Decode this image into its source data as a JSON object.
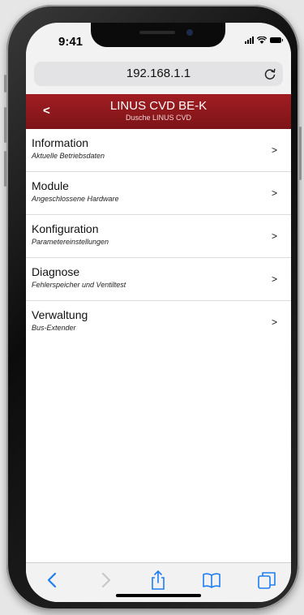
{
  "status": {
    "time": "9:41"
  },
  "browser": {
    "url": "192.168.1.1"
  },
  "header": {
    "back": "<",
    "title": "LINUS CVD BE-K",
    "subtitle": "Dusche LINUS CVD"
  },
  "menu": [
    {
      "label": "Information",
      "desc": "Aktuelle Betriebsdaten",
      "chevron": ">"
    },
    {
      "label": "Module",
      "desc": "Angeschlossene Hardware",
      "chevron": ">"
    },
    {
      "label": "Konfiguration",
      "desc": "Parametereinstellungen",
      "chevron": ">"
    },
    {
      "label": "Diagnose",
      "desc": "Fehlerspeicher und Ventiltest",
      "chevron": ">"
    },
    {
      "label": "Verwaltung",
      "desc": "Bus-Extender",
      "chevron": ">"
    }
  ],
  "icons": {
    "reload": "reload-icon",
    "toolbar": [
      "back-icon",
      "forward-icon",
      "share-icon",
      "bookmarks-icon",
      "tabs-icon"
    ]
  },
  "colors": {
    "header": "#8f1a1d",
    "toolbar_icon": "#1e7cf2",
    "toolbar_icon_disabled": "#c8c8c8"
  }
}
